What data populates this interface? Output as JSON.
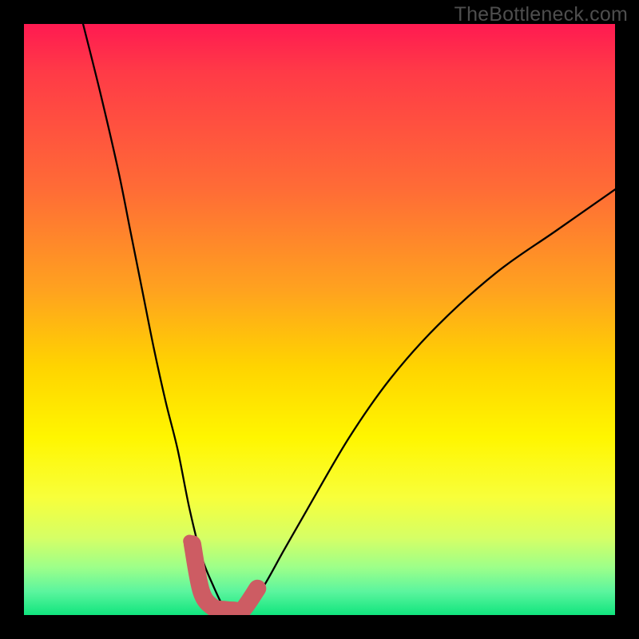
{
  "watermark": "TheBottleneck.com",
  "chart_data": {
    "type": "line",
    "title": "",
    "xlabel": "",
    "ylabel": "",
    "xlim": [
      0,
      100
    ],
    "ylim": [
      0,
      100
    ],
    "series": [
      {
        "name": "bottleneck-curve",
        "x": [
          10,
          13,
          16,
          18,
          20,
          22,
          24,
          26,
          28,
          30,
          32,
          34,
          35.5,
          37,
          40,
          44,
          48,
          55,
          62,
          70,
          80,
          90,
          100
        ],
        "y": [
          100,
          88,
          75,
          65,
          55,
          45,
          36,
          28,
          18,
          10,
          5,
          1,
          0.5,
          1,
          4,
          11,
          18,
          30,
          40,
          49,
          58,
          65,
          72
        ]
      }
    ],
    "highlight_segment": {
      "name": "pink-cap",
      "color": "#cd5c63",
      "x": [
        28.5,
        30,
        32,
        34,
        35.5,
        37,
        39.5
      ],
      "y": [
        12,
        4,
        1.3,
        0.9,
        0.8,
        0.9,
        4.5
      ]
    },
    "highlight_dot": {
      "name": "pink-dot",
      "color": "#cd5c63",
      "x": 28,
      "y": 12.5
    }
  }
}
